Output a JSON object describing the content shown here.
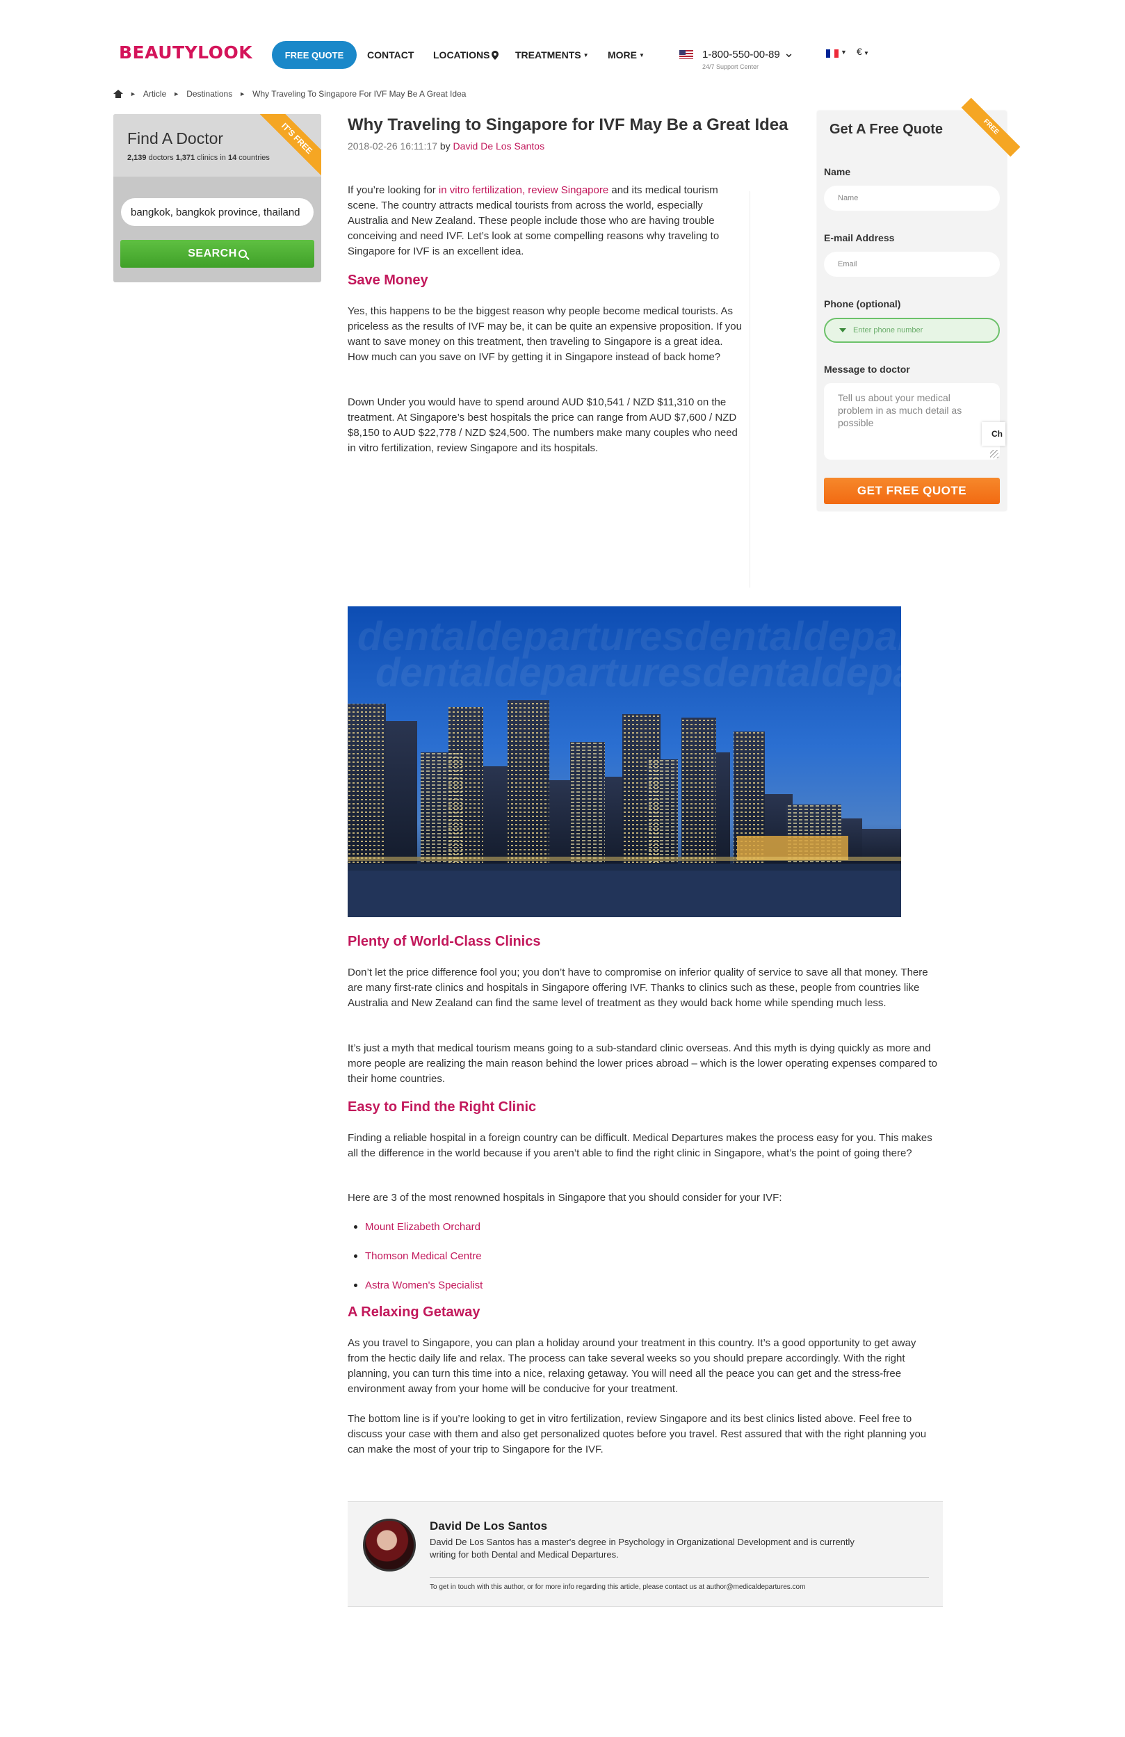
{
  "header": {
    "logo": "BEAUTYLOOK",
    "quote_button": "FREE QUOTE",
    "nav": {
      "contact": "CONTACT",
      "locations": "LOCATIONS",
      "treatments": "TREATMENTS",
      "more": "MORE"
    },
    "phone": "1-800-550-00-89",
    "phone_sub": "24/7 Support Center",
    "currency": "€"
  },
  "breadcrumb": [
    "Article",
    "Destinations",
    "Why Traveling To Singapore For IVF May Be A Great Idea"
  ],
  "find_doctor": {
    "title": "Find A Doctor",
    "doctors": "2,139",
    "doctors_label": "doctors",
    "clinics": "1,371",
    "clinics_label": "clinics in",
    "countries": "14",
    "countries_label": "countries",
    "ribbon": "IT'S FREE",
    "location_value": "bangkok, bangkok province, thailand",
    "search_label": "SEARCH"
  },
  "article": {
    "title": "Why Traveling to Singapore for IVF May Be a Great Idea",
    "date": "2018-02-26 16:11:17",
    "by": "by",
    "author": "David De Los Santos",
    "intro_pre": "If you’re looking for ",
    "intro_link": "in vitro fertilization, review Singapore",
    "intro_post": " and its medical tourism scene. The country attracts medical tourists from across the world, especially Australia and New Zealand. These people include those who are having trouble conceiving and need IVF. Let’s look at some compelling reasons why traveling to Singapore for IVF is an excellent idea.",
    "h_save": "Save Money",
    "p_save1": "Yes, this happens to be the biggest reason why people become medical tourists. As priceless as the results of IVF may be, it can be quite an expensive proposition. If you want to save money on this treatment, then traveling to Singapore is a great idea. How much can you save on IVF by getting it in Singapore instead of back home?",
    "p_save2": "Down Under you would have to spend around AUD $10,541 / NZD $11,310 on the treatment. At Singapore’s best hospitals the price can range from AUD $7,600 / NZD $8,150 to AUD $22,778 / NZD $24,500. The numbers make many couples who need in vitro fertilization, review Singapore and its hospitals.",
    "watermark": "dentaldeparturesdentaldepartures",
    "h_clinics": "Plenty of World-Class Clinics",
    "p_clinics1": "Don’t let the price difference fool you; you don’t have to compromise on inferior quality of service to save all that money. There are many first-rate clinics and hospitals in Singapore offering IVF. Thanks to clinics such as these, people from countries like Australia and New Zealand can find the same level of treatment as they would back home while spending much less.",
    "p_clinics2": "It’s just a myth that medical tourism means going to a sub-standard clinic overseas. And this myth is dying quickly as more and more people are realizing the main reason behind the lower prices abroad – which is the lower operating expenses compared to their home countries.",
    "h_find": "Easy to Find the Right Clinic",
    "p_find1": "Finding a reliable hospital in a foreign country can be difficult. Medical Departures makes the process easy for you. This makes all the difference in the world because if you aren’t able to find the right clinic in Singapore, what’s the point of going there?",
    "p_find2": "Here are 3 of the most renowned hospitals in Singapore that you should consider for your IVF:",
    "hospitals": [
      "Mount Elizabeth Orchard",
      "Thomson Medical Centre",
      "Astra Women's Specialist"
    ],
    "h_relax": "A Relaxing Getaway",
    "p_relax1": "As you travel to Singapore, you can plan a holiday around your treatment in this country. It’s a good opportunity to get away from the hectic daily life and relax. The process can take several weeks so you should prepare accordingly. With the right planning, you can turn this time into a nice, relaxing getaway. You will need all the peace you can get and the stress-free environment away from your home will be conducive for your treatment.",
    "p_relax2": "The bottom line is if you’re looking to get in vitro fertilization, review Singapore and its best clinics listed above. Feel free to discuss your case with them and also get personalized quotes before you travel. Rest assured that with the right planning you can make the most of your trip to Singapore for the IVF."
  },
  "quote_form": {
    "title": "Get A Free Quote",
    "ribbon": "FREE",
    "name_label": "Name",
    "name_placeholder": "Name",
    "email_label": "E-mail Address",
    "email_placeholder": "Email",
    "phone_label": "Phone (optional)",
    "phone_placeholder": "Enter phone number",
    "message_label": "Message to doctor",
    "message_placeholder": "Tell us about your medical problem in as much detail as possible",
    "submit": "GET FREE QUOTE",
    "chat_tab": "Ch"
  },
  "author_box": {
    "name": "David De Los Santos",
    "bio": "David De Los Santos has a master's degree in Psychology in Organizational Development and is currently writing for both Dental and Medical Departures.",
    "contact": "To get in touch with this author, or for more info regarding this article, please contact us at author@medicaldepartures.com"
  }
}
